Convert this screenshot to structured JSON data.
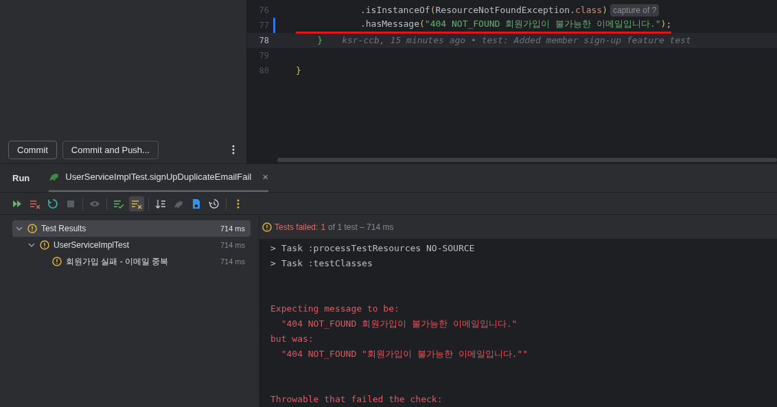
{
  "commit_panel": {
    "buttons": [
      {
        "label": "Commit",
        "kind": "primary"
      },
      {
        "label": "Commit and Push..."
      }
    ]
  },
  "editor": {
    "lines": [
      {
        "number": "76",
        "current": false,
        "modified": false,
        "tokens": [
          {
            "text": "            .isInstanceOf",
            "kind": "plain"
          },
          {
            "text": "(",
            "kind": "paren"
          },
          {
            "text": "ResourceNotFoundException.",
            "kind": "plain"
          },
          {
            "text": "class",
            "kind": "keyword"
          },
          {
            "text": ")",
            "kind": "paren"
          }
        ],
        "hint": "capture of ?"
      },
      {
        "number": "77",
        "current": false,
        "modified": true,
        "underlined": true,
        "tokens": [
          {
            "text": "            .hasMessage",
            "kind": "plain"
          },
          {
            "text": "(",
            "kind": "paren"
          },
          {
            "text": "\"404 NOT_FOUND 회원가입이 불가능한 이메일입니다.\"",
            "kind": "string"
          },
          {
            "text": ")",
            "kind": "paren"
          },
          {
            "text": ";",
            "kind": "plain"
          }
        ]
      },
      {
        "number": "78",
        "current": true,
        "modified": false,
        "tokens": [
          {
            "text": "    }",
            "kind": "brace-match"
          }
        ],
        "blame": "ksr-ccb, 15 minutes ago • test: Added member sign-up feature test"
      },
      {
        "number": "79",
        "current": false,
        "modified": false
      },
      {
        "number": "80",
        "current": false,
        "modified": false,
        "tokens": [
          {
            "text": "}",
            "kind": "paren"
          }
        ]
      }
    ]
  },
  "run_panel": {
    "title": "Run",
    "tab": {
      "label": "UserServiceImplTest.signUpDuplicateEmailFail",
      "close": "×"
    },
    "toolbar": [
      {
        "kind": "rerun-failed",
        "disabled": false,
        "selected": false
      },
      {
        "kind": "clear-failed",
        "disabled": false,
        "selected": false
      },
      {
        "kind": "rerun",
        "disabled": false,
        "selected": false
      },
      {
        "kind": "stop",
        "disabled": true,
        "selected": false,
        "separator_after": true
      },
      {
        "kind": "eye",
        "disabled": true,
        "selected": false,
        "separator_after": true
      },
      {
        "kind": "show-passed",
        "disabled": false,
        "selected": false
      },
      {
        "kind": "show-ignored",
        "disabled": false,
        "selected": true,
        "separator_after": true
      },
      {
        "kind": "sort",
        "disabled": false,
        "selected": false
      },
      {
        "kind": "import",
        "disabled": true,
        "selected": false
      },
      {
        "kind": "export",
        "disabled": false,
        "selected": false
      },
      {
        "kind": "history",
        "disabled": false,
        "selected": false,
        "separator_after": true
      },
      {
        "kind": "more",
        "disabled": false,
        "selected": false
      }
    ],
    "tree": [
      {
        "label": "Test Results",
        "time": "714 ms",
        "selected": true,
        "expanded": true,
        "children": [
          {
            "label": "UserServiceImplTest",
            "time": "714 ms",
            "selected": false,
            "expanded": true,
            "children": [
              {
                "label": "회원가입 실패 - 이메일 중복",
                "time": "714 ms",
                "selected": false
              }
            ]
          }
        ]
      }
    ],
    "summary": [
      {
        "text": "Tests failed:",
        "kind": "fail"
      },
      {
        "text": "1",
        "kind": "fail"
      },
      {
        "text": "of 1 test – 714 ms",
        "kind": "muted"
      }
    ],
    "console": [
      {
        "lines": [
          {
            "text": "> Task :processTestResources NO-SOURCE",
            "kind": "normal"
          },
          {
            "text": "> Task :testClasses",
            "kind": "normal"
          }
        ]
      },
      {
        "lines": [
          {
            "text": "Expecting message to be:",
            "kind": "error"
          },
          {
            "text": "  \"404 NOT_FOUND 회원가입이 불가능한 이메일입니다.\"",
            "kind": "error"
          },
          {
            "text": "but was:",
            "kind": "error"
          },
          {
            "text": "  \"404 NOT_FOUND \"회원가입이 불가능한 이메일입니다.\"\"",
            "kind": "error"
          }
        ]
      },
      {
        "lines": [
          {
            "text": "Throwable that failed the check:",
            "kind": "error"
          }
        ]
      }
    ]
  }
}
